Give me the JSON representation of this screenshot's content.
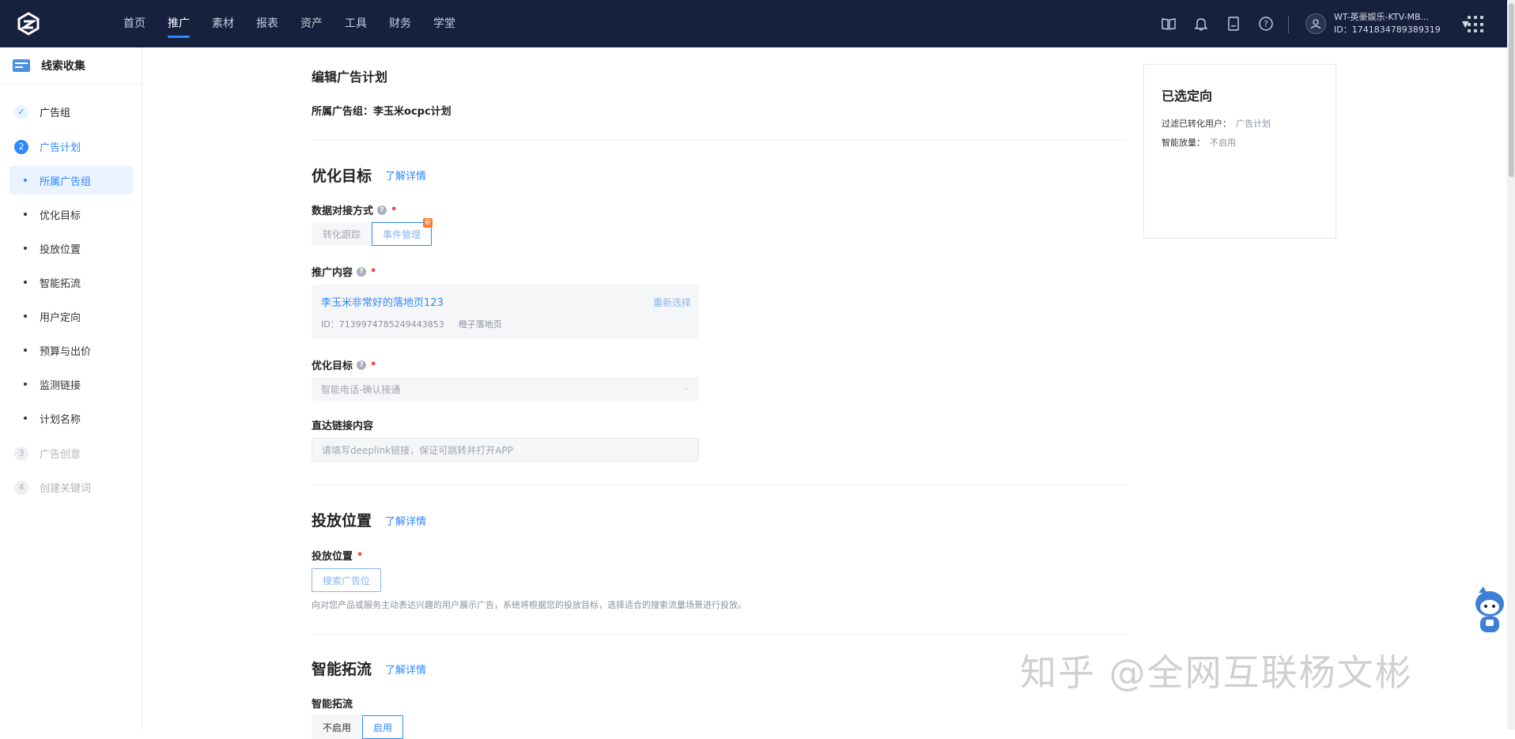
{
  "topbar": {
    "nav": [
      "首页",
      "推广",
      "素材",
      "报表",
      "资产",
      "工具",
      "财务",
      "学堂"
    ],
    "active_nav": 1,
    "icons": [
      "book-icon",
      "bell-icon",
      "document-icon",
      "help-icon"
    ],
    "account": {
      "name": "WT-英豪娱乐-KTV-MB...",
      "id": "ID：1741834789389319"
    }
  },
  "sidebar": {
    "header": "线索收集",
    "steps": [
      {
        "num": "✓",
        "label": "广告组"
      },
      {
        "num": "2",
        "label": "广告计划"
      },
      {
        "num": "3",
        "label": "广告创意"
      },
      {
        "num": "4",
        "label": "创建关键词"
      }
    ],
    "subitems": [
      "所属广告组",
      "优化目标",
      "投放位置",
      "智能拓流",
      "用户定向",
      "预算与出价",
      "监测链接",
      "计划名称"
    ]
  },
  "main": {
    "page_title": "编辑广告计划",
    "adgroup_label": "所属广告组：",
    "adgroup_value": "李玉米ocpc计划",
    "optimize": {
      "title": "优化目标",
      "link": "了解详情",
      "data_method_label": "数据对接方式",
      "data_method_options": [
        "转化跟踪",
        "事件管理"
      ],
      "new_badge": "新",
      "content_label": "推广内容",
      "content_title": "李玉米非常好的落地页123",
      "content_id": "ID：7139974785249443853",
      "content_type": "橙子落地页",
      "reselect": "重新选择",
      "goal_label": "优化目标",
      "goal_value": "智能电话-确认接通",
      "deeplink_label": "直达链接内容",
      "deeplink_placeholder": "请填写deeplink链接，保证可跳转并打开APP"
    },
    "placement": {
      "title": "投放位置",
      "link": "了解详情",
      "label": "投放位置",
      "button": "搜索广告位",
      "hint": "向对您产品或服务主动表达兴趣的用户展示广告，系统将根据您的投放目标，选择适合的搜索流量场景进行投放。"
    },
    "smart": {
      "title": "智能拓流",
      "link": "了解详情",
      "label": "智能拓流",
      "options": [
        "不启用",
        "启用"
      ]
    }
  },
  "right_card": {
    "title": "已选定向",
    "rows": [
      {
        "k": "过滤已转化用户：",
        "v": "广告计划"
      },
      {
        "k": "智能放量：",
        "v": "不启用"
      }
    ]
  },
  "watermark": "知乎 @全网互联杨文彬",
  "colors": {
    "topbar": "#16213e",
    "accent": "#2f88ff",
    "required": "#f54a45"
  }
}
